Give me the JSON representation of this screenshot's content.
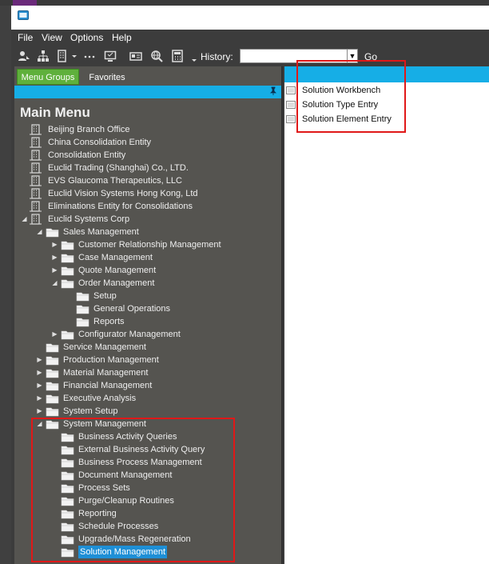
{
  "menubar": {
    "items": [
      "File",
      "View",
      "Options",
      "Help"
    ]
  },
  "toolbar": {
    "history_label": "History:",
    "history_value": "",
    "go_label": "Go"
  },
  "tabs": {
    "menu_groups": "Menu Groups",
    "favorites": "Favorites"
  },
  "panel": {
    "title": "Main Menu"
  },
  "tree": [
    {
      "label": "Beijing Branch Office",
      "level": 0,
      "icon": "company",
      "expander": "none"
    },
    {
      "label": "China Consolidation Entity",
      "level": 0,
      "icon": "company",
      "expander": "none"
    },
    {
      "label": "Consolidation Entity",
      "level": 0,
      "icon": "company",
      "expander": "none"
    },
    {
      "label": "Euclid Trading (Shanghai) Co., LTD.",
      "level": 0,
      "icon": "company",
      "expander": "none"
    },
    {
      "label": "EVS Glaucoma Therapeutics, LLC",
      "level": 0,
      "icon": "company",
      "expander": "none"
    },
    {
      "label": "Euclid Vision Systems Hong Kong, Ltd",
      "level": 0,
      "icon": "company",
      "expander": "none"
    },
    {
      "label": "Eliminations Entity for Consolidations",
      "level": 0,
      "icon": "company",
      "expander": "none"
    },
    {
      "label": "Euclid Systems Corp",
      "level": 0,
      "icon": "company",
      "expander": "expanded"
    },
    {
      "label": "Sales Management",
      "level": 1,
      "icon": "folder",
      "expander": "expanded"
    },
    {
      "label": "Customer Relationship Management",
      "level": 2,
      "icon": "folder",
      "expander": "collapsed"
    },
    {
      "label": "Case Management",
      "level": 2,
      "icon": "folder",
      "expander": "collapsed"
    },
    {
      "label": "Quote Management",
      "level": 2,
      "icon": "folder",
      "expander": "collapsed"
    },
    {
      "label": "Order Management",
      "level": 2,
      "icon": "folder",
      "expander": "expanded"
    },
    {
      "label": "Setup",
      "level": 3,
      "icon": "folder",
      "expander": "none"
    },
    {
      "label": "General Operations",
      "level": 3,
      "icon": "folder",
      "expander": "none"
    },
    {
      "label": "Reports",
      "level": 3,
      "icon": "folder",
      "expander": "none"
    },
    {
      "label": "Configurator Management",
      "level": 2,
      "icon": "folder",
      "expander": "collapsed"
    },
    {
      "label": "Service Management",
      "level": 1,
      "icon": "folder",
      "expander": "none"
    },
    {
      "label": "Production Management",
      "level": 1,
      "icon": "folder",
      "expander": "collapsed"
    },
    {
      "label": "Material Management",
      "level": 1,
      "icon": "folder",
      "expander": "collapsed"
    },
    {
      "label": "Financial Management",
      "level": 1,
      "icon": "folder",
      "expander": "collapsed"
    },
    {
      "label": "Executive Analysis",
      "level": 1,
      "icon": "folder",
      "expander": "collapsed"
    },
    {
      "label": "System Setup",
      "level": 1,
      "icon": "folder",
      "expander": "collapsed"
    },
    {
      "label": "System Management",
      "level": 1,
      "icon": "folder",
      "expander": "expanded"
    },
    {
      "label": "Business Activity Queries",
      "level": 2,
      "icon": "folder",
      "expander": "none"
    },
    {
      "label": "External Business Activity Query",
      "level": 2,
      "icon": "folder",
      "expander": "none"
    },
    {
      "label": "Business Process Management",
      "level": 2,
      "icon": "folder",
      "expander": "none"
    },
    {
      "label": "Document Management",
      "level": 2,
      "icon": "folder",
      "expander": "none"
    },
    {
      "label": "Process Sets",
      "level": 2,
      "icon": "folder",
      "expander": "none"
    },
    {
      "label": "Purge/Cleanup Routines",
      "level": 2,
      "icon": "folder",
      "expander": "none"
    },
    {
      "label": "Reporting",
      "level": 2,
      "icon": "folder",
      "expander": "none"
    },
    {
      "label": "Schedule Processes",
      "level": 2,
      "icon": "folder",
      "expander": "none"
    },
    {
      "label": "Upgrade/Mass Regeneration",
      "level": 2,
      "icon": "folder",
      "expander": "none"
    },
    {
      "label": "Solution Management",
      "level": 2,
      "icon": "folder",
      "expander": "none",
      "selected": true
    }
  ],
  "right_panel": {
    "items": [
      "Solution Workbench",
      "Solution Type Entry",
      "Solution Element Entry"
    ]
  },
  "colors": {
    "accent": "#16aee6",
    "selected": "#1e8fd6",
    "tab_active": "#5fb03c",
    "highlight_box": "#e01818",
    "panel_bg": "#555450"
  }
}
